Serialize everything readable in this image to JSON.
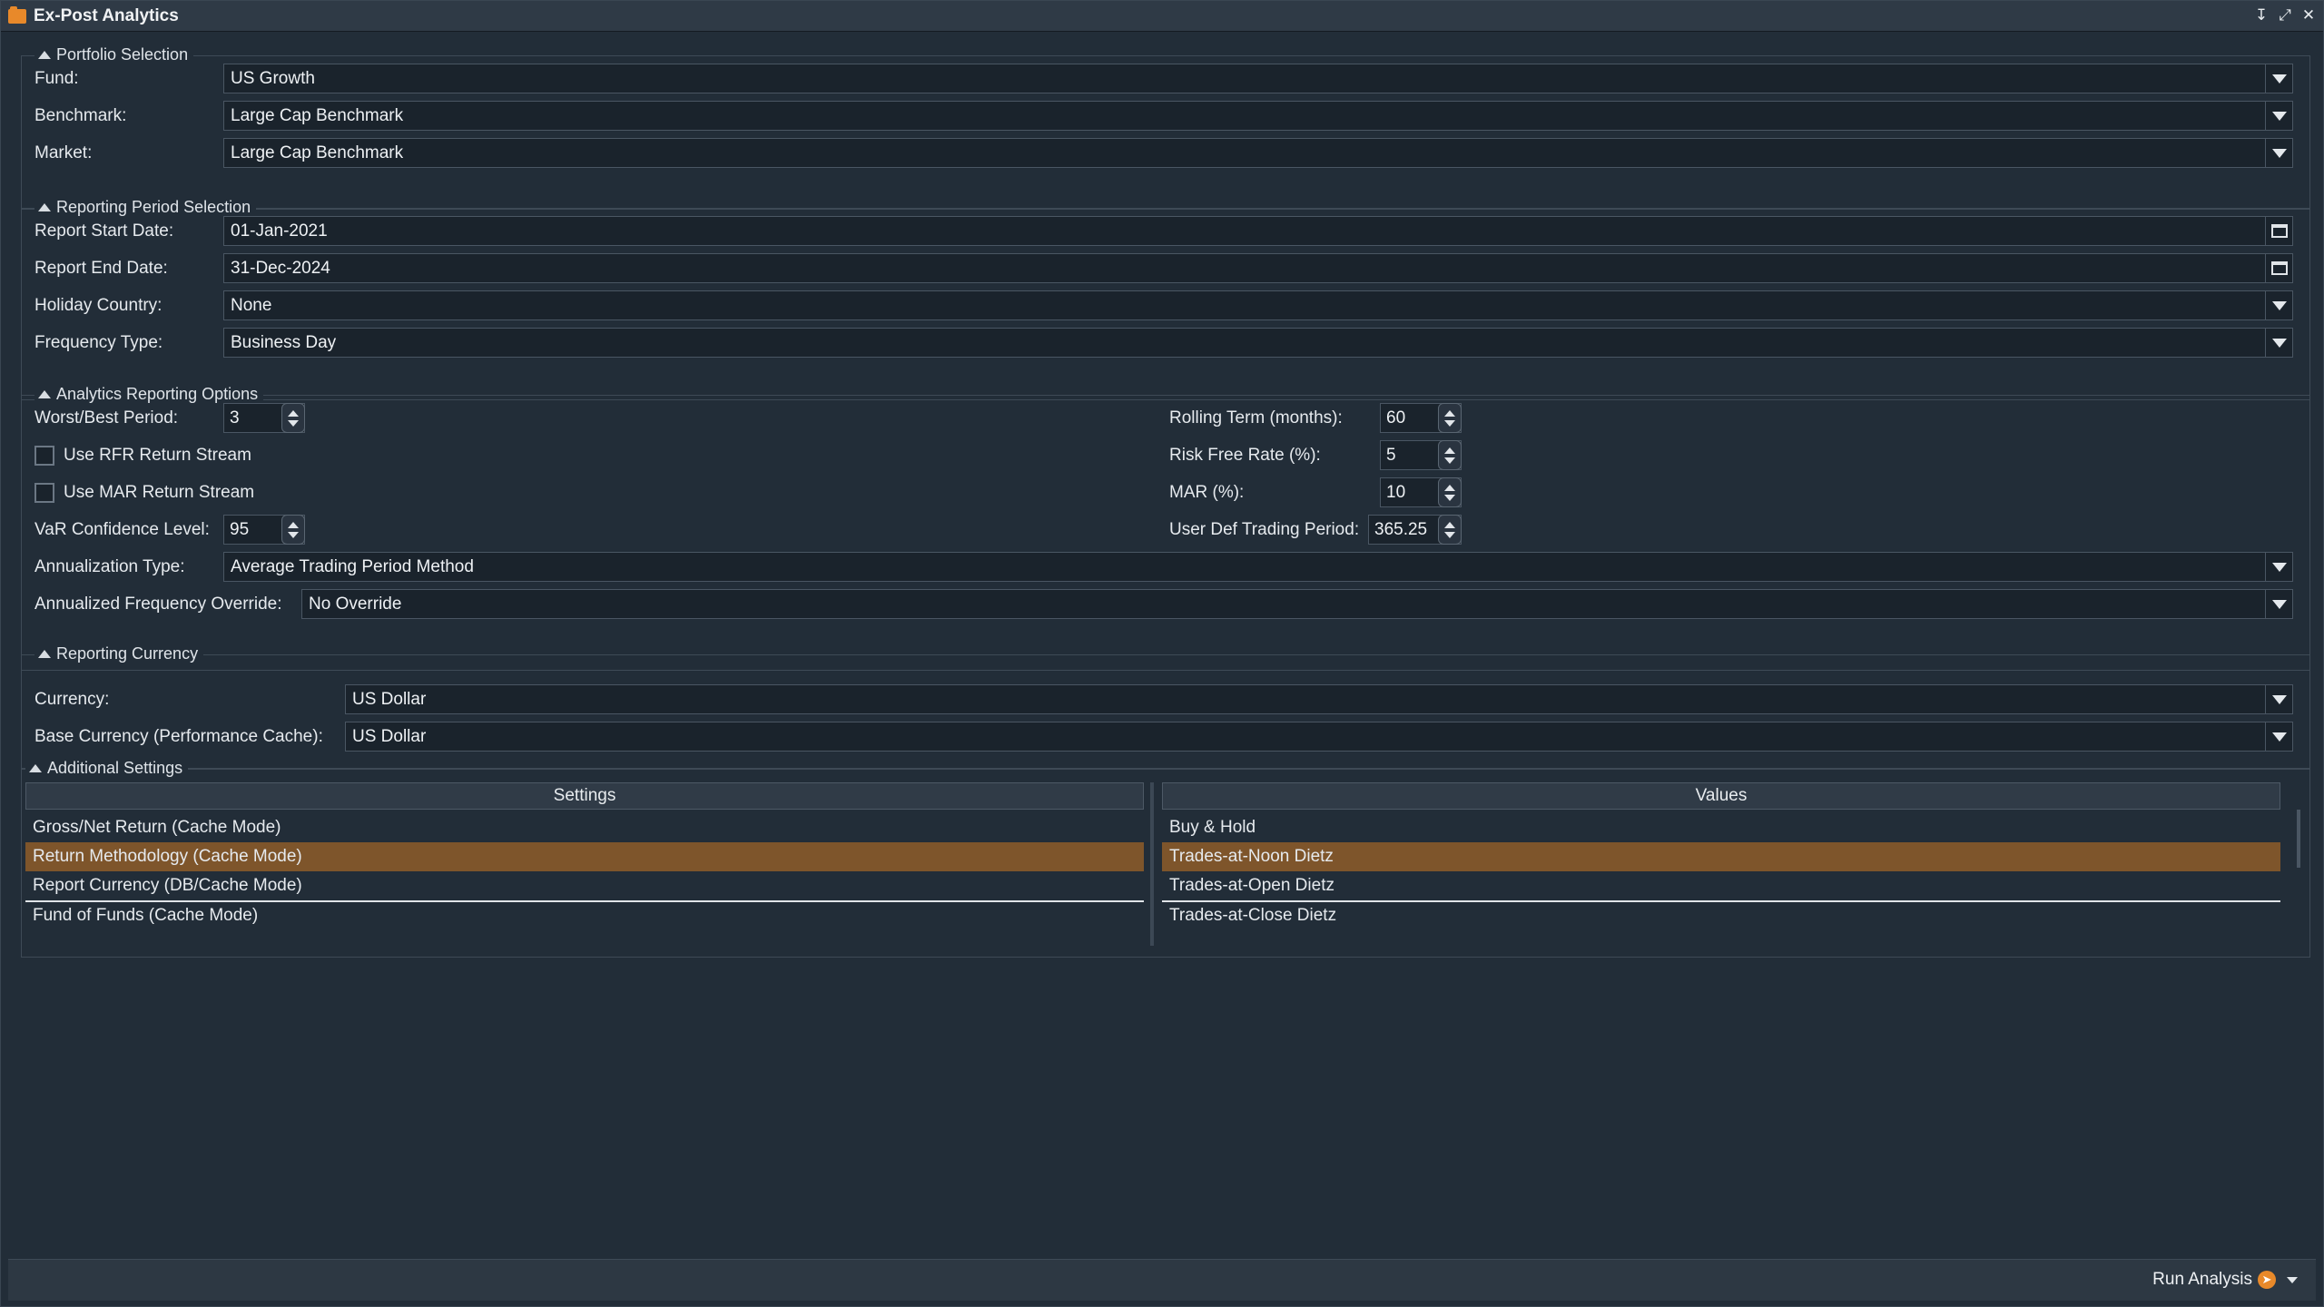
{
  "window": {
    "title": "Ex-Post Analytics"
  },
  "portfolio": {
    "legend": "Portfolio Selection",
    "fund_label": "Fund:",
    "fund_value": "US Growth",
    "benchmark_label": "Benchmark:",
    "benchmark_value": "Large Cap Benchmark",
    "market_label": "Market:",
    "market_value": "Large Cap Benchmark"
  },
  "period": {
    "legend": "Reporting Period Selection",
    "start_label": "Report Start Date:",
    "start_value": "01-Jan-2021",
    "end_label": "Report End Date:",
    "end_value": "31-Dec-2024",
    "holiday_label": "Holiday Country:",
    "holiday_value": "None",
    "frequency_label": "Frequency Type:",
    "frequency_value": "Business Day"
  },
  "analytics": {
    "legend": "Analytics Reporting Options",
    "worst_best_label": "Worst/Best Period:",
    "worst_best_value": "3",
    "rfr_label": "Use RFR Return Stream",
    "mar_stream_label": "Use MAR Return Stream",
    "var_label": "VaR Confidence Level:",
    "var_value": "95",
    "rolling_label": "Rolling Term (months):",
    "rolling_value": "60",
    "rfr_rate_label": "Risk Free Rate (%):",
    "rfr_rate_value": "5",
    "mar_label": "MAR (%):",
    "mar_value": "10",
    "trading_label": "User Def Trading Period:",
    "trading_value": "365.25",
    "annualization_label": "Annualization Type:",
    "annualization_value": "Average Trading Period Method",
    "override_label": "Annualized Frequency Override:",
    "override_value": "No Override"
  },
  "currency": {
    "legend": "Reporting Currency",
    "currency_label": "Currency:",
    "currency_value": "US Dollar",
    "base_label": "Base Currency (Performance Cache):",
    "base_value": "US Dollar"
  },
  "additional": {
    "legend": "Additional Settings",
    "settings_header": "Settings",
    "values_header": "Values",
    "settings_rows": [
      "Gross/Net Return (Cache Mode)",
      "Return Methodology (Cache Mode)",
      "Report Currency (DB/Cache Mode)",
      "Fund of Funds (Cache Mode)"
    ],
    "value_rows": [
      "Buy & Hold",
      "Trades-at-Noon Dietz",
      "Trades-at-Open Dietz",
      "Trades-at-Close Dietz"
    ]
  },
  "status": {
    "run_label": "Run Analysis"
  },
  "colors": {
    "accent": "#e8892a",
    "selection": "#7e552b",
    "background": "#222d38"
  }
}
